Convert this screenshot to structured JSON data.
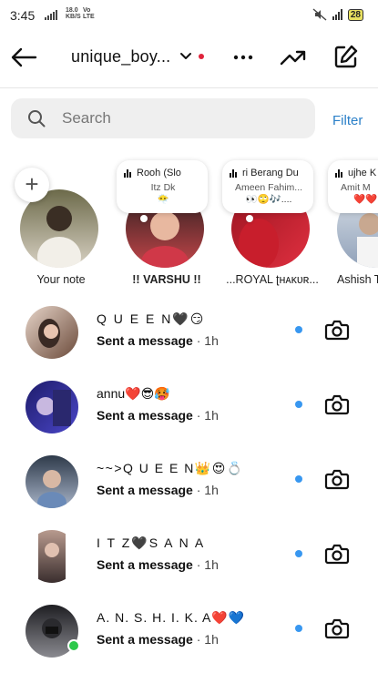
{
  "status_bar": {
    "time": "3:45",
    "net_speed_top": "18.0",
    "net_speed_bottom": "KB/S",
    "volte_top": "Vo",
    "volte_bottom": "LTE",
    "battery": "28"
  },
  "header": {
    "username": "unique_boy...",
    "back_icon": "arrow-left-icon",
    "chevron_icon": "chevron-down-icon",
    "more_icon": "more-horizontal-icon",
    "trend_icon": "trending-up-icon",
    "compose_icon": "edit-icon"
  },
  "search": {
    "placeholder": "Search",
    "filter_label": "Filter"
  },
  "notes": [
    {
      "label": "Your note",
      "bubble": null,
      "avatar_colors": [
        "#6c6a4a",
        "#d9d2c4"
      ]
    },
    {
      "label": "!! VARSHU !!",
      "bubble": {
        "title": "Rooh (Slo",
        "subtitle": "Itz Dk",
        "extra": "😶‍🌫️"
      },
      "avatar_colors": [
        "#2a1e1e",
        "#c4464a"
      ]
    },
    {
      "label": "...ROYAL ʈʜᴀᴋᴜʀ...",
      "bubble": {
        "title": "ri Berang Du",
        "subtitle": "Ameen Fahim...",
        "extra": "👀🙄🎶...."
      },
      "avatar_colors": [
        "#9b1420",
        "#e03040"
      ]
    },
    {
      "label": "Ashish T",
      "bubble": {
        "title": "ujhe K",
        "subtitle": "Amit M",
        "extra": "❤️❤️"
      },
      "avatar_colors": [
        "#d9e0e8",
        "#8fa0b8"
      ]
    }
  ],
  "chats": [
    {
      "name": "Q U E E N🖤😏",
      "status": "Sent a message",
      "time": "· 1h",
      "avatar_colors": [
        "#e6d4c8",
        "#6b4a3a"
      ]
    },
    {
      "name": "annu❤️😎🥵",
      "status": "Sent a message",
      "time": "· 1h",
      "avatar_colors": [
        "#1e1c6a",
        "#4a46c8"
      ]
    },
    {
      "name": "~~>Q U E E N👑😍💍",
      "status": "Sent a message",
      "time": "· 1h",
      "avatar_colors": [
        "#2e3a4a",
        "#a8b4c8"
      ]
    },
    {
      "name": "I T Z🖤S A N A",
      "status": "Sent a message",
      "time": "· 1h",
      "avatar_colors": [
        "#b89a8e",
        "#3a2e2e"
      ]
    },
    {
      "name": "A. N. S. H. I. K. A❤️💙",
      "status": "Sent a message",
      "time": "· 1h",
      "avatar_colors": [
        "#1e1e22",
        "#8a8a90"
      ]
    }
  ],
  "colors": {
    "accent_blue": "#3897f0",
    "link_blue": "#2a7fc8",
    "online_green": "#2cc84a",
    "red_dot": "#e0243b"
  },
  "icons": {
    "search": "search-icon",
    "camera": "camera-icon",
    "add_note": "plus-icon"
  }
}
